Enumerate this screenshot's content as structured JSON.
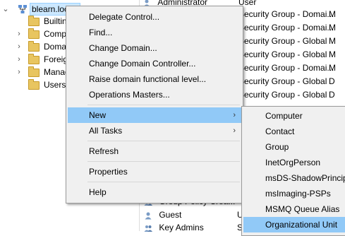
{
  "tree": {
    "root_label": "blearn.local",
    "items": [
      {
        "label": "Builtin",
        "expandable": false
      },
      {
        "label": "Computers",
        "expandable": true
      },
      {
        "label": "Domain Controllers",
        "expandable": true
      },
      {
        "label": "ForeignSecurityPrincipals",
        "expandable": true
      },
      {
        "label": "Managed Service Accounts",
        "expandable": true
      },
      {
        "label": "Users",
        "expandable": false
      }
    ]
  },
  "list": {
    "rows": [
      {
        "name": "Administrator",
        "type": "User",
        "desc": ""
      },
      {
        "name": "",
        "type": "Security Group - Domai...",
        "desc": "M"
      },
      {
        "name": "",
        "type": "Security Group - Domai...",
        "desc": "M"
      },
      {
        "name": "",
        "type": "Security Group - Global",
        "desc": "M"
      },
      {
        "name": "",
        "type": "Security Group - Global",
        "desc": "M"
      },
      {
        "name": "",
        "type": "Security Group - Domai...",
        "desc": "M"
      },
      {
        "name": "",
        "type": "Security Group - Global",
        "desc": "D"
      },
      {
        "name": "",
        "type": "Security Group - Global",
        "desc": "D"
      }
    ],
    "bottom_rows": [
      {
        "name": "Group Policy Crea...",
        "type": ""
      },
      {
        "name": "Guest",
        "type": "U"
      },
      {
        "name": "Key Admins",
        "type": "S"
      }
    ]
  },
  "context_menu": {
    "items_top": [
      "Delegate Control...",
      "Find...",
      "Change Domain...",
      "Change Domain Controller...",
      "Raise domain functional level...",
      "Operations Masters..."
    ],
    "new_label": "New",
    "all_tasks_label": "All Tasks",
    "refresh_label": "Refresh",
    "properties_label": "Properties",
    "help_label": "Help",
    "submenu_arrow": "›"
  },
  "submenu": {
    "items": [
      "Computer",
      "Contact",
      "Group",
      "InetOrgPerson",
      "msDS-ShadowPrincip",
      "msImaging-PSPs",
      "MSMQ Queue Alias",
      "Organizational Unit"
    ]
  }
}
